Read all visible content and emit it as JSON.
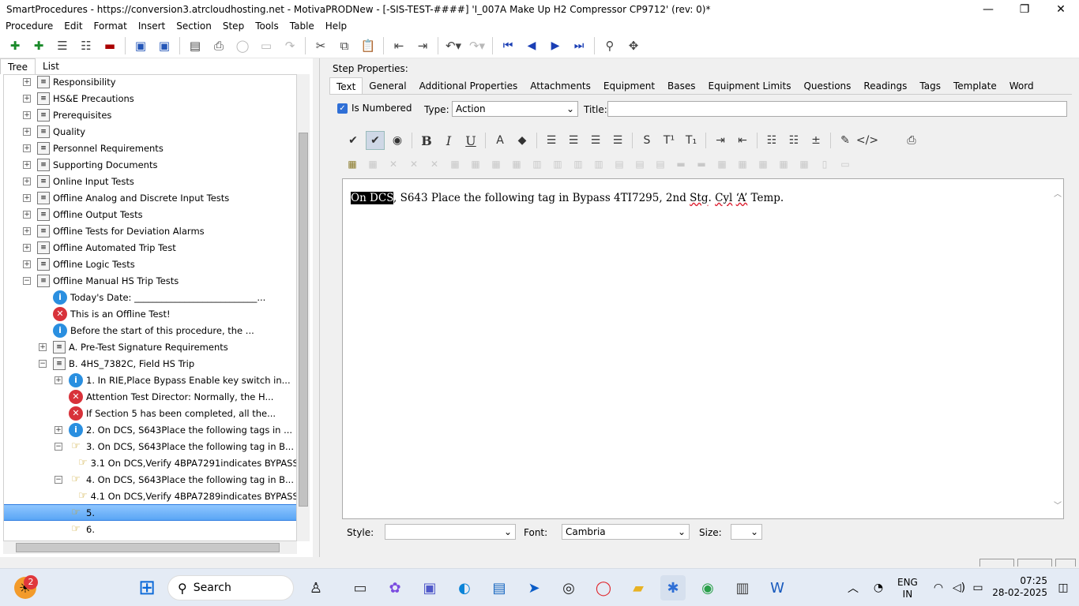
{
  "window": {
    "title": "SmartProcedures - https://conversion3.atrcloudhosting.net - MotivaPRODNew - [-SIS-TEST-####] 'I_007A Make Up H2 Compressor CP9712' (rev: 0)*",
    "minimize": "—",
    "maximize": "❐",
    "close": "✕"
  },
  "menu": [
    "Procedure",
    "Edit",
    "Format",
    "Insert",
    "Section",
    "Step",
    "Tools",
    "Table",
    "Help"
  ],
  "left_tabs": [
    "Tree",
    "List"
  ],
  "tree": [
    {
      "label": "Responsibility",
      "icon": "doc-icon",
      "exp": "+",
      "indent": 0
    },
    {
      "label": "HS&E Precautions",
      "icon": "doc-icon",
      "exp": "+",
      "indent": 0
    },
    {
      "label": "Prerequisites",
      "icon": "doc-icon",
      "exp": "+",
      "indent": 0
    },
    {
      "label": "Quality",
      "icon": "doc-icon",
      "exp": "+",
      "indent": 0
    },
    {
      "label": "Personnel Requirements",
      "icon": "doc-icon",
      "exp": "+",
      "indent": 0
    },
    {
      "label": "Supporting Documents",
      "icon": "doc-icon",
      "exp": "+",
      "indent": 0
    },
    {
      "label": "Online Input Tests",
      "icon": "doc-icon",
      "exp": "+",
      "indent": 0
    },
    {
      "label": "Offline Analog and Discrete Input Tests",
      "icon": "doc-icon",
      "exp": "+",
      "indent": 0
    },
    {
      "label": "Offline Output Tests",
      "icon": "doc-icon",
      "exp": "+",
      "indent": 0
    },
    {
      "label": "Offline Tests for Deviation Alarms",
      "icon": "doc-icon",
      "exp": "+",
      "indent": 0
    },
    {
      "label": "Offline Automated Trip Test",
      "icon": "doc-icon",
      "exp": "+",
      "indent": 0
    },
    {
      "label": "Offline Logic Tests",
      "icon": "doc-icon",
      "exp": "+",
      "indent": 0
    },
    {
      "label": "Offline Manual HS Trip Tests",
      "icon": "doc-icon",
      "exp": "−",
      "indent": 0
    },
    {
      "label": "Today's Date: ___________________________...",
      "icon": "info-icon",
      "exp": "",
      "indent": 1
    },
    {
      "label": "This is an Offline Test!",
      "icon": "error-icon",
      "exp": "",
      "indent": 1
    },
    {
      "label": "Before the start of this procedure, the ...",
      "icon": "info-icon",
      "exp": "",
      "indent": 1
    },
    {
      "label": "A. Pre-Test Signature Requirements",
      "icon": "doc-icon",
      "exp": "+",
      "indent": 1
    },
    {
      "label": "B. 4HS_7382C, Field HS Trip",
      "icon": "doc-icon",
      "exp": "−",
      "indent": 1
    },
    {
      "label": "1. In RIE,Place Bypass Enable key switch in...",
      "icon": "info-icon",
      "exp": "+",
      "indent": 2
    },
    {
      "label": "Attention Test Director: Normally, the H...",
      "icon": "error-icon",
      "exp": "",
      "indent": 2
    },
    {
      "label": "If Section 5 has been completed, all the...",
      "icon": "error-icon",
      "exp": "",
      "indent": 2
    },
    {
      "label": "2. On DCS, S643Place the following tags in ...",
      "icon": "info-icon",
      "exp": "+",
      "indent": 2
    },
    {
      "label": "3. On DCS, S643Place the following tag in B...",
      "icon": "hand-icon",
      "exp": "−",
      "indent": 2
    },
    {
      "label": "3.1  On DCS,Verify 4BPA7291indicates BYPASS...",
      "icon": "hand-icon",
      "exp": "",
      "indent": 3
    },
    {
      "label": "4. On DCS, S643Place the following tag in B...",
      "icon": "hand-icon",
      "exp": "−",
      "indent": 2
    },
    {
      "label": "4.1  On DCS,Verify 4BPA7289indicates BYPASS...",
      "icon": "hand-icon",
      "exp": "",
      "indent": 3
    },
    {
      "label": "5.",
      "icon": "hand-icon",
      "exp": "",
      "indent": 2,
      "selected": true
    },
    {
      "label": "6.",
      "icon": "hand-icon",
      "exp": "",
      "indent": 2
    }
  ],
  "step_properties": {
    "label": "Step Properties:",
    "tabs": [
      "Text",
      "General",
      "Additional Properties",
      "Attachments",
      "Equipment",
      "Bases",
      "Equipment Limits",
      "Questions",
      "Readings",
      "Tags",
      "Template",
      "Word"
    ],
    "is_numbered_label": "Is Numbered",
    "type_label": "Type:",
    "type_value": "Action",
    "title_label": "Title:",
    "title_value": "",
    "editor_text_highlight": "On DCS",
    "editor_text_a": ", S643 Place the following tag in Bypass 4TI7295, 2nd ",
    "editor_text_stg": "Stg",
    "editor_text_b": ". ",
    "editor_text_cyl": "Cyl",
    "editor_text_c": " ",
    "editor_text_a2": "‘A’",
    "editor_text_d": " Temp.",
    "style_label": "Style:",
    "style_value": "",
    "font_label": "Font:",
    "font_value": "Cambria",
    "size_label": "Size:",
    "size_value": ""
  },
  "taskbar": {
    "search_placeholder": "Search",
    "notification_count": "2",
    "lang_top": "ENG",
    "lang_bottom": "IN",
    "time": "07:25",
    "date": "28-02-2025"
  }
}
